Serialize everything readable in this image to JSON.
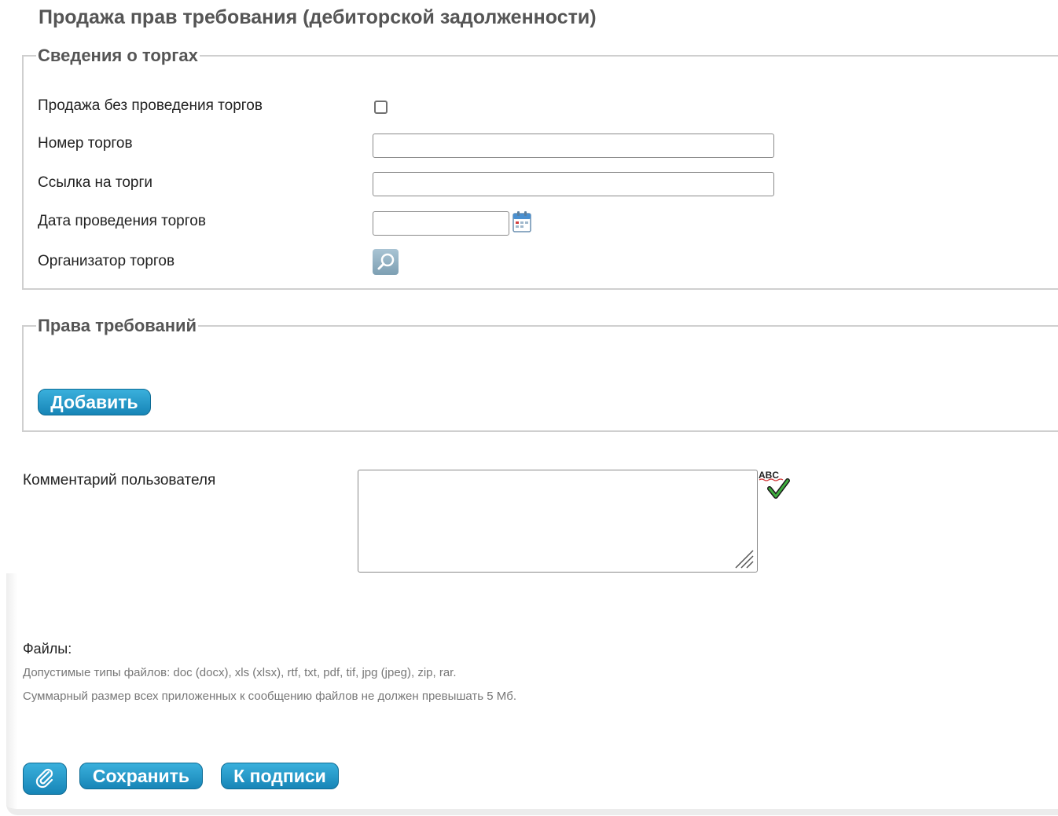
{
  "page": {
    "title": "Продажа прав требования (дебиторской задолженности)"
  },
  "auction": {
    "legend": "Сведения о торгах",
    "no_auction_label": "Продажа без проведения торгов",
    "no_auction_checked": false,
    "number_label": "Номер торгов",
    "number_value": "",
    "link_label": "Ссылка на торги",
    "link_value": "",
    "date_label": "Дата проведения торгов",
    "date_value": "",
    "organizer_label": "Организатор торгов"
  },
  "claims": {
    "legend": "Права требований",
    "add_button": "Добавить"
  },
  "comment": {
    "label": "Комментарий пользователя",
    "value": ""
  },
  "files": {
    "label": "Файлы:",
    "allowed_types": "Допустимые типы файлов: doc (docx), xls (xlsx), rtf, txt, pdf, tif, jpg (jpeg), zip, rar.",
    "size_limit": "Суммарный размер всех приложенных к сообщению файлов не должен превышать 5 Мб."
  },
  "actions": {
    "save_button": "Сохранить",
    "sign_button": "К подписи"
  },
  "icons": {
    "calendar": "calendar-icon",
    "search": "magnifier-icon",
    "spellcheck": "spellcheck-icon",
    "attach": "paperclip-icon"
  },
  "colors": {
    "button_top": "#3ab0dc",
    "button_bottom": "#1785b7",
    "heading": "#555555",
    "note": "#777777"
  }
}
